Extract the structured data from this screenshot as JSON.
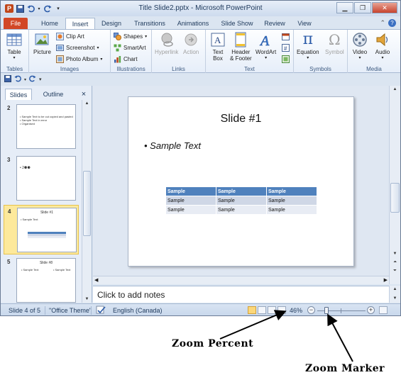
{
  "window": {
    "title": "Title Slide2.pptx  -  Microsoft PowerPoint",
    "app_icon": "P",
    "controls": [
      "minimize-icon",
      "restore-icon",
      "close-icon"
    ]
  },
  "tabs": [
    {
      "label": "File"
    },
    {
      "label": "Home"
    },
    {
      "label": "Insert"
    },
    {
      "label": "Design"
    },
    {
      "label": "Transitions"
    },
    {
      "label": "Animations"
    },
    {
      "label": "Slide Show"
    },
    {
      "label": "Review"
    },
    {
      "label": "View"
    }
  ],
  "active_tab": "Insert",
  "ribbon": {
    "tables": {
      "label": "Tables",
      "table": "Table"
    },
    "images": {
      "label": "Images",
      "picture": "Picture",
      "clip_art": "Clip Art",
      "screenshot": "Screenshot",
      "photo_album": "Photo Album"
    },
    "illustrations": {
      "label": "Illustrations",
      "shapes": "Shapes",
      "smartart": "SmartArt",
      "chart": "Chart"
    },
    "links": {
      "label": "Links",
      "hyperlink": "Hyperlink",
      "action": "Action"
    },
    "text": {
      "label": "Text",
      "text_box_1": "Text",
      "text_box_2": "Box",
      "header_1": "Header",
      "header_2": "& Footer",
      "wordart": "WordArt"
    },
    "symbols": {
      "label": "Symbols",
      "equation": "Equation",
      "symbol": "Symbol",
      "pi": "π",
      "omega": "Ω"
    },
    "media": {
      "label": "Media",
      "video": "Video",
      "audio": "Audio"
    }
  },
  "left_pane": {
    "tabs": [
      "Slides",
      "Outline"
    ],
    "close": "×",
    "thumbnails": [
      {
        "num": "2",
        "lines": [
          "• Sample Text to be cut copied and pasted",
          "• Sample Text in error",
          "• Organised"
        ]
      },
      {
        "num": "3",
        "lines": [
          "• 2⚈⚈"
        ]
      },
      {
        "num": "4",
        "title": "Slide #1",
        "lines": [
          "• Sample Text"
        ]
      },
      {
        "num": "5",
        "title": "Slide #8",
        "lines": [
          "• Sample Text",
          "• Sample Text"
        ]
      }
    ]
  },
  "slide": {
    "title": "Slide #1",
    "bullet": "Sample Text",
    "table": {
      "header": [
        "Sample",
        "Sample",
        "Sample"
      ],
      "rows": [
        [
          "Sample",
          "Sample",
          "Sample"
        ],
        [
          "Sample",
          "Sample",
          "Sample"
        ]
      ]
    }
  },
  "notes": {
    "placeholder": "Click to add notes"
  },
  "status": {
    "slide": "Slide 4 of 5",
    "theme": "\"Office Theme\"",
    "language": "English (Canada)",
    "zoom": "46%",
    "zoom_out": "−",
    "zoom_in": "+"
  },
  "annotations": {
    "zoom_percent": "Zoom Percent",
    "zoom_marker": "Zoom Marker"
  }
}
